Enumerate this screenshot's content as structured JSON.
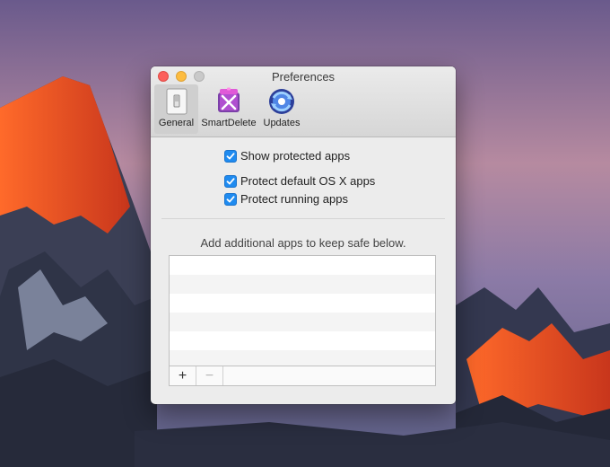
{
  "window": {
    "title": "Preferences"
  },
  "toolbar": {
    "tabs": [
      {
        "label": "General",
        "icon": "switch-icon",
        "active": true
      },
      {
        "label": "SmartDelete",
        "icon": "smartdelete-icon",
        "active": false
      },
      {
        "label": "Updates",
        "icon": "updates-icon",
        "active": false
      }
    ]
  },
  "options": [
    {
      "label": "Show protected apps",
      "checked": true
    },
    {
      "label": "Protect default OS X apps",
      "checked": true
    },
    {
      "label": "Protect running apps",
      "checked": true
    }
  ],
  "apps_list": {
    "hint": "Add additional apps to keep safe below.",
    "add_label": "+",
    "remove_label": "−"
  },
  "colors": {
    "checkbox": "#1f8bf0",
    "close": "#fc605c",
    "minimize": "#fdbc40",
    "zoom": "#c9c9c9"
  }
}
